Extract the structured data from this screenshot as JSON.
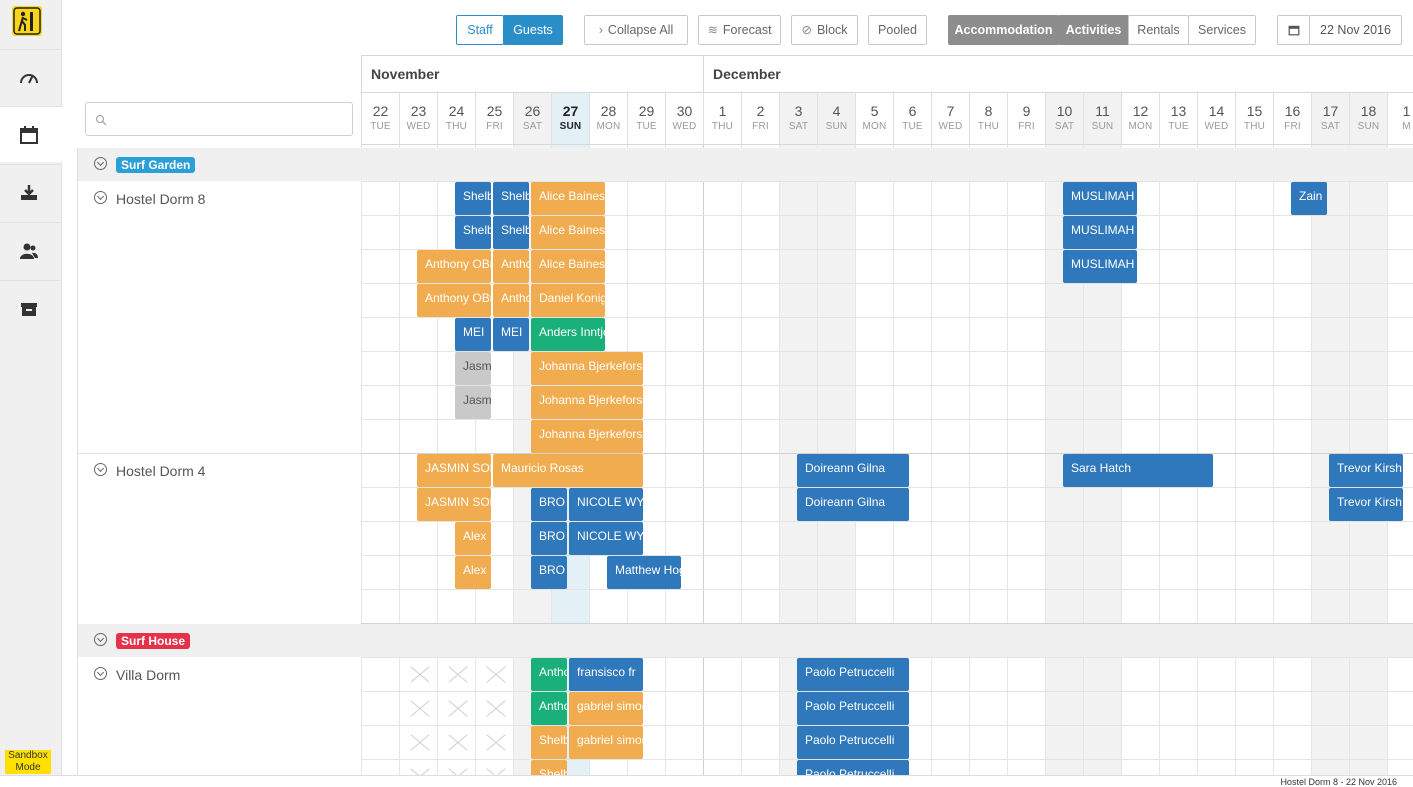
{
  "colors": {
    "accent": "#2a8fc9",
    "blue_booking": "#2f78bb",
    "orange_booking": "#f0ac4e",
    "green_booking": "#1ab07a",
    "grey_booking": "#c9c9c9",
    "surf_garden": "#2a9fd8",
    "surf_house": "#e5324a",
    "sandbox": "#ffe000"
  },
  "sidebar": {
    "items": [
      {
        "name": "dashboard",
        "icon": "speedometer-icon"
      },
      {
        "name": "calendar",
        "icon": "calendar-icon",
        "active": true
      },
      {
        "name": "inbox",
        "icon": "download-tray-icon"
      },
      {
        "name": "guests",
        "icon": "users-icon"
      },
      {
        "name": "inventory",
        "icon": "box-icon"
      }
    ],
    "sandbox_label": "Sandbox Mode"
  },
  "toolbar": {
    "staff": "Staff",
    "guests": "Guests",
    "collapse_all": "Collapse All",
    "forecast": "Forecast",
    "block": "Block",
    "pooled": "Pooled",
    "accommodation": "Accommodation",
    "activities": "Activities",
    "rentals": "Rentals",
    "services": "Services",
    "date": "22 Nov 2016"
  },
  "search": {
    "placeholder": "",
    "value": ""
  },
  "calendar": {
    "months": [
      {
        "label": "November"
      },
      {
        "label": "December"
      }
    ],
    "days": [
      {
        "n": "22",
        "d": "TUE"
      },
      {
        "n": "23",
        "d": "WED"
      },
      {
        "n": "24",
        "d": "THU"
      },
      {
        "n": "25",
        "d": "FRI"
      },
      {
        "n": "26",
        "d": "SAT",
        "wk": true
      },
      {
        "n": "27",
        "d": "SUN",
        "today": true
      },
      {
        "n": "28",
        "d": "MON"
      },
      {
        "n": "29",
        "d": "TUE"
      },
      {
        "n": "30",
        "d": "WED"
      },
      {
        "n": "1",
        "d": "THU"
      },
      {
        "n": "2",
        "d": "FRI"
      },
      {
        "n": "3",
        "d": "SAT",
        "wk": true
      },
      {
        "n": "4",
        "d": "SUN",
        "wk": true
      },
      {
        "n": "5",
        "d": "MON"
      },
      {
        "n": "6",
        "d": "TUE"
      },
      {
        "n": "7",
        "d": "WED"
      },
      {
        "n": "8",
        "d": "THU"
      },
      {
        "n": "9",
        "d": "FRI"
      },
      {
        "n": "10",
        "d": "SAT",
        "wk": true
      },
      {
        "n": "11",
        "d": "SUN",
        "wk": true
      },
      {
        "n": "12",
        "d": "MON"
      },
      {
        "n": "13",
        "d": "TUE"
      },
      {
        "n": "14",
        "d": "WED"
      },
      {
        "n": "15",
        "d": "THU"
      },
      {
        "n": "16",
        "d": "FRI"
      },
      {
        "n": "17",
        "d": "SAT",
        "wk": true
      },
      {
        "n": "18",
        "d": "SUN",
        "wk": true
      },
      {
        "n": "1",
        "d": "M"
      }
    ]
  },
  "groups": [
    {
      "label": "Surf Garden",
      "color": "#2a9fd8",
      "rooms": [
        "Hostel Dorm 8",
        "Hostel Dorm 4"
      ]
    },
    {
      "label": "Surf House",
      "color": "#e5324a",
      "rooms": [
        "Villa Dorm"
      ]
    }
  ],
  "bookings": [
    {
      "name": "Shelby",
      "color": "blue",
      "start": 2,
      "len": 1,
      "row": 0
    },
    {
      "name": "Shelby",
      "color": "blue",
      "start": 3,
      "len": 1,
      "row": 0
    },
    {
      "name": "Alice Baines",
      "color": "orange",
      "start": 4,
      "len": 2,
      "row": 0
    },
    {
      "name": "MUSLIMAH",
      "color": "blue",
      "start": 18,
      "len": 2,
      "row": 0
    },
    {
      "name": "Zain",
      "color": "blue",
      "start": 24,
      "len": 1,
      "row": 0
    },
    {
      "name": "Shelby",
      "color": "blue",
      "start": 2,
      "len": 1,
      "row": 1
    },
    {
      "name": "Shelby",
      "color": "blue",
      "start": 3,
      "len": 1,
      "row": 1
    },
    {
      "name": "Alice Baines",
      "color": "orange",
      "start": 4,
      "len": 2,
      "row": 1
    },
    {
      "name": "MUSLIMAH",
      "color": "blue",
      "start": 18,
      "len": 2,
      "row": 1
    },
    {
      "name": "Anthony OBrien",
      "color": "orange",
      "start": 1,
      "len": 2,
      "row": 2
    },
    {
      "name": "Anthony",
      "color": "orange",
      "start": 3,
      "len": 1,
      "row": 2
    },
    {
      "name": "Alice Baines",
      "color": "orange",
      "start": 4,
      "len": 2,
      "row": 2
    },
    {
      "name": "MUSLIMAH",
      "color": "blue",
      "start": 18,
      "len": 2,
      "row": 2
    },
    {
      "name": "Anthony OBrien",
      "color": "orange",
      "start": 1,
      "len": 2,
      "row": 3
    },
    {
      "name": "Anthony",
      "color": "orange",
      "start": 3,
      "len": 1,
      "row": 3
    },
    {
      "name": "Daniel Konig",
      "color": "orange",
      "start": 4,
      "len": 2,
      "row": 3
    },
    {
      "name": "MEI",
      "color": "blue",
      "start": 2,
      "len": 1,
      "row": 4
    },
    {
      "name": "MEI",
      "color": "blue",
      "start": 3,
      "len": 1,
      "row": 4
    },
    {
      "name": "Anders Inntjore",
      "color": "green",
      "start": 4,
      "len": 2,
      "row": 4
    },
    {
      "name": "Jasmin",
      "color": "grey",
      "start": 2,
      "len": 1,
      "row": 5
    },
    {
      "name": "Johanna Bjerkeforsen",
      "color": "orange",
      "start": 4,
      "len": 3,
      "row": 5
    },
    {
      "name": "Jasmin",
      "color": "grey",
      "start": 2,
      "len": 1,
      "row": 6
    },
    {
      "name": "Johanna Bjerkeforsen",
      "color": "orange",
      "start": 4,
      "len": 3,
      "row": 6
    },
    {
      "name": "Johanna Bjerkeforsen",
      "color": "orange",
      "start": 4,
      "len": 3,
      "row": 7
    },
    {
      "name": "JASMIN SOL",
      "color": "orange",
      "start": 1,
      "len": 2,
      "row": 8
    },
    {
      "name": "Mauricio Rosas",
      "color": "orange",
      "start": 3,
      "len": 4,
      "row": 8
    },
    {
      "name": "Doireann Gilna",
      "color": "blue",
      "start": 11,
      "len": 3,
      "row": 8
    },
    {
      "name": "Sara Hatch",
      "color": "blue",
      "start": 18,
      "len": 4,
      "row": 8
    },
    {
      "name": "Trevor Kirsh",
      "color": "blue",
      "start": 25,
      "len": 2,
      "row": 8
    },
    {
      "name": "JASMIN SOL",
      "color": "orange",
      "start": 1,
      "len": 2,
      "row": 9
    },
    {
      "name": "BRO",
      "color": "blue",
      "start": 4,
      "len": 1,
      "row": 9
    },
    {
      "name": "NICOLE WYATT",
      "color": "blue",
      "start": 5,
      "len": 2,
      "row": 9
    },
    {
      "name": "Doireann Gilna",
      "color": "blue",
      "start": 11,
      "len": 3,
      "row": 9
    },
    {
      "name": "Trevor Kirsh",
      "color": "blue",
      "start": 25,
      "len": 2,
      "row": 9
    },
    {
      "name": "Alex",
      "color": "orange",
      "start": 2,
      "len": 1,
      "row": 10
    },
    {
      "name": "BRO",
      "color": "blue",
      "start": 4,
      "len": 1,
      "row": 10
    },
    {
      "name": "NICOLE WYATT",
      "color": "blue",
      "start": 5,
      "len": 2,
      "row": 10
    },
    {
      "name": "Alex",
      "color": "orange",
      "start": 2,
      "len": 1,
      "row": 11
    },
    {
      "name": "BRO",
      "color": "blue",
      "start": 4,
      "len": 1,
      "row": 11
    },
    {
      "name": "Matthew Hogan",
      "color": "blue",
      "start": 6,
      "len": 2,
      "row": 11
    },
    {
      "name": "Anthony",
      "color": "green",
      "start": 4,
      "len": 1,
      "row": 13
    },
    {
      "name": "fransisco fr",
      "color": "blue",
      "start": 5,
      "len": 2,
      "row": 13
    },
    {
      "name": "Paolo Petruccelli",
      "color": "blue",
      "start": 11,
      "len": 3,
      "row": 13
    },
    {
      "name": "Anthony",
      "color": "green",
      "start": 4,
      "len": 1,
      "row": 14
    },
    {
      "name": "gabriel simons",
      "color": "orange",
      "start": 5,
      "len": 2,
      "row": 14
    },
    {
      "name": "Paolo Petruccelli",
      "color": "blue",
      "start": 11,
      "len": 3,
      "row": 14
    },
    {
      "name": "Shelby",
      "color": "orange",
      "start": 4,
      "len": 1,
      "row": 15
    },
    {
      "name": "gabriel simons",
      "color": "orange",
      "start": 5,
      "len": 2,
      "row": 15
    },
    {
      "name": "Paolo Petruccelli",
      "color": "blue",
      "start": 11,
      "len": 3,
      "row": 15
    },
    {
      "name": "Shelby",
      "color": "orange",
      "start": 4,
      "len": 1,
      "row": 16
    },
    {
      "name": "Paolo Petruccelli",
      "color": "blue",
      "start": 11,
      "len": 3,
      "row": 16
    }
  ],
  "status_bar": "Hostel Dorm 8 - 22 Nov 2016"
}
